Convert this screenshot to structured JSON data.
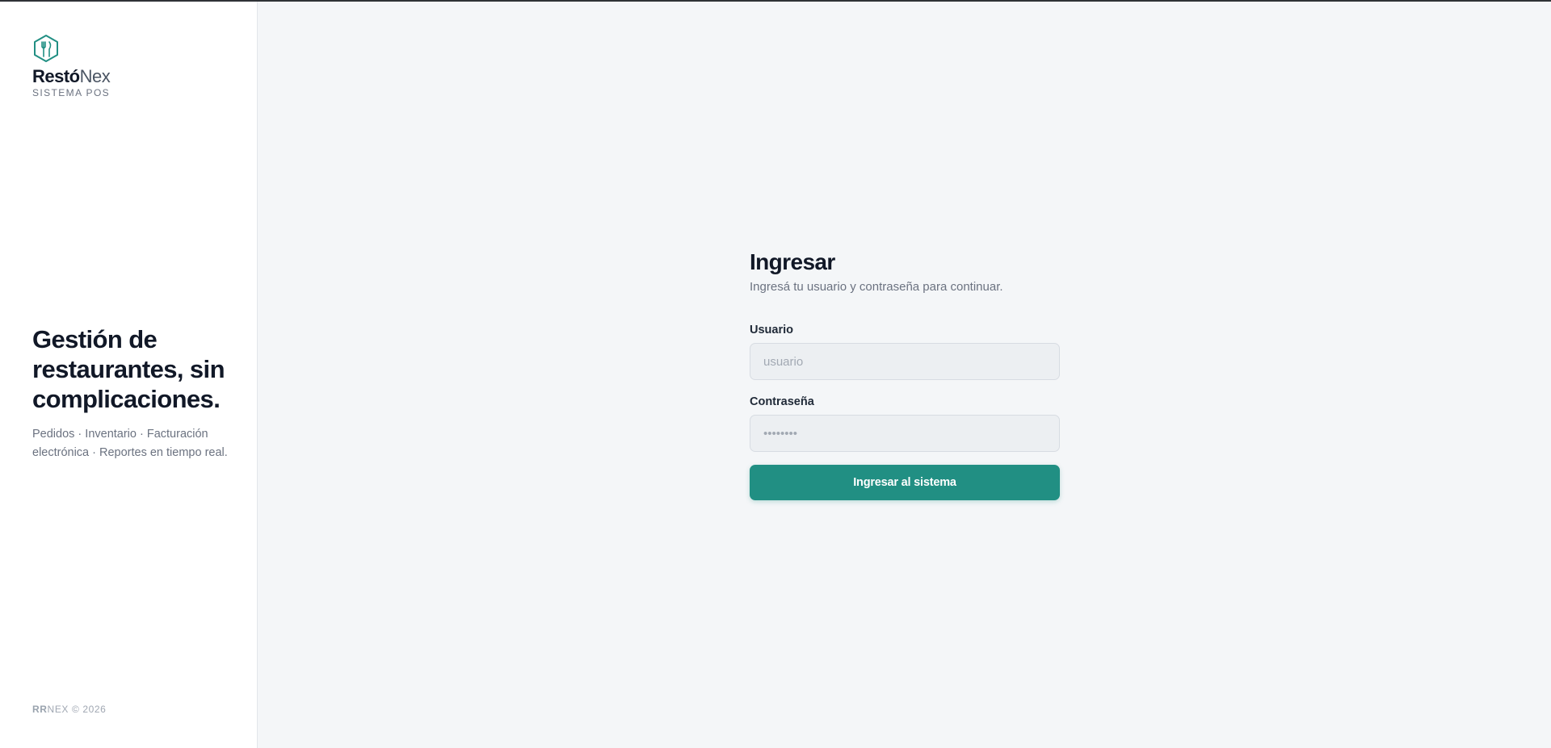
{
  "brand": {
    "name_bold": "Restó",
    "name_light": "Nex",
    "subtitle": "SISTEMA POS",
    "icon": "fork-knife-hexagon-icon"
  },
  "hero": {
    "title": "Gestión de restaurantes, sin complicaciones.",
    "description": "Pedidos · Inventario · Facturación electrónica · Reportes en tiempo real."
  },
  "footer": {
    "brand_bold": "RR",
    "text": "NEX © 2026"
  },
  "login": {
    "title": "Ingresar",
    "subtitle": "Ingresá tu usuario y contraseña para continuar.",
    "username_label": "Usuario",
    "username_placeholder": "usuario",
    "username_value": "",
    "password_label": "Contraseña",
    "password_placeholder": "••••••••",
    "password_value": "",
    "submit_label": "Ingresar al sistema"
  },
  "colors": {
    "accent": "#218f83",
    "background": "#f4f6f8",
    "sidebar": "#ffffff"
  }
}
